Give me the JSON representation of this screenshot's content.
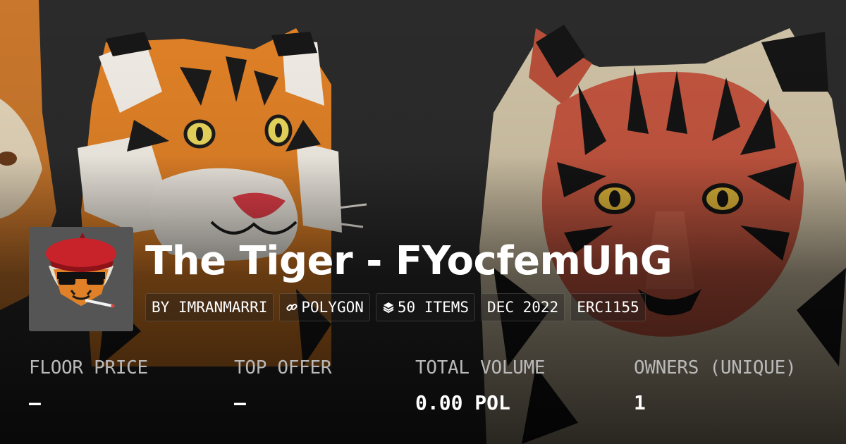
{
  "collection": {
    "title": "The Tiger - FYocfemUhG",
    "tags": {
      "creator": "BY IMRANMARRI",
      "chain": "POLYGON",
      "items": "50 ITEMS",
      "date": "DEC 2022",
      "standard": "ERC1155"
    },
    "icons": {
      "chain": "link-icon",
      "items": "layers-icon",
      "avatar": "tiger-beret-avatar-icon"
    }
  },
  "stats": {
    "floor_price": {
      "label": "FLOOR PRICE",
      "value": "–"
    },
    "top_offer": {
      "label": "TOP OFFER",
      "value": "–"
    },
    "total_volume": {
      "label": "TOTAL VOLUME",
      "value": "0.00 POL"
    },
    "owners": {
      "label": "OWNERS (UNIQUE)",
      "value": "1"
    }
  },
  "colors": {
    "background": "#1f1f1f",
    "text": "#ffffff",
    "muted_text": "#b9b9b9",
    "tiger_orange": "#e0822a",
    "tiger_red": "#c25a3f",
    "beret_red": "#c8232a"
  }
}
